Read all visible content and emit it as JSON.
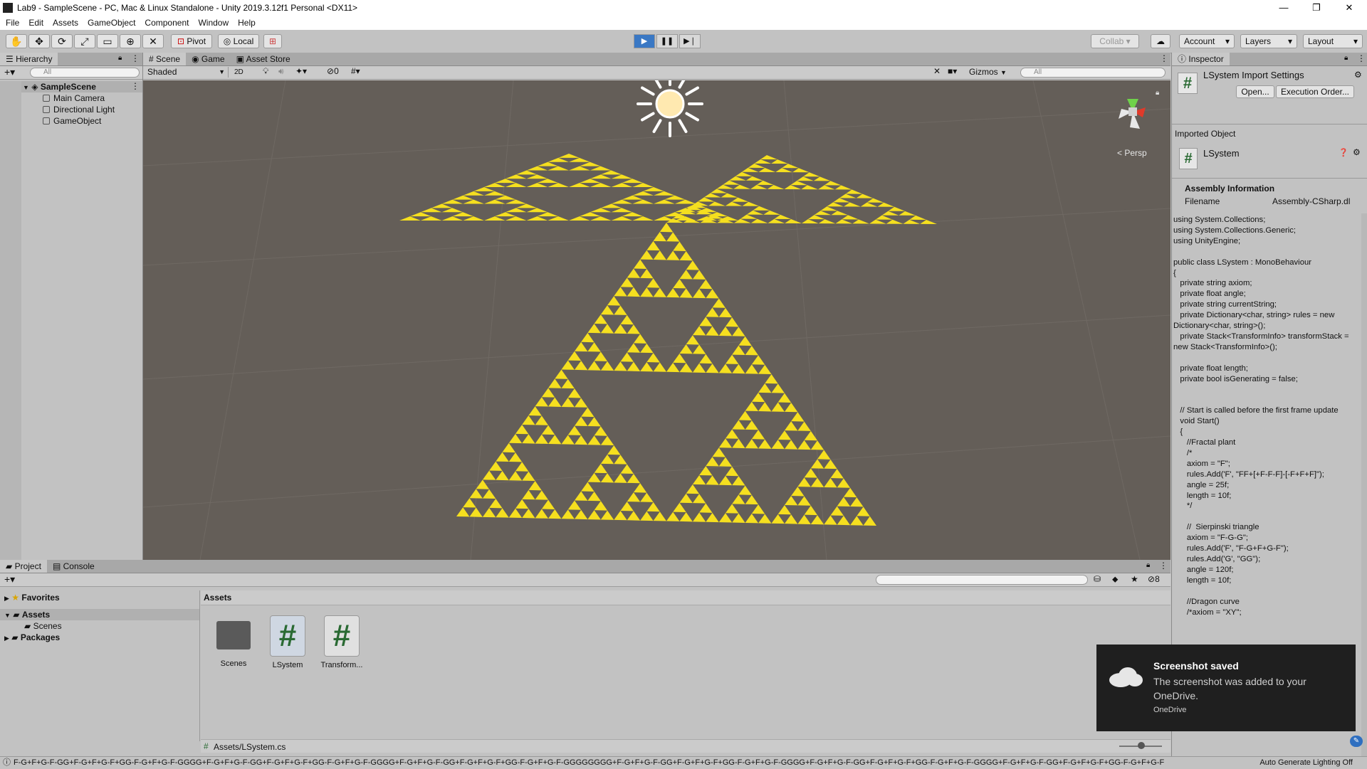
{
  "window": {
    "title": "Lab9 - SampleScene - PC, Mac & Linux Standalone - Unity 2019.3.12f1 Personal <DX11>",
    "minimize": "—",
    "maximize": "❐",
    "close": "✕"
  },
  "menu": [
    "File",
    "Edit",
    "Assets",
    "GameObject",
    "Component",
    "Window",
    "Help"
  ],
  "toolbar": {
    "tools": [
      "hand-tool-icon",
      "move-tool-icon",
      "rotate-tool-icon",
      "scale-tool-icon",
      "rect-tool-icon",
      "transform-tool-icon",
      "custom-tool-icon"
    ],
    "pivot": "Pivot",
    "local": "Local",
    "collab": "Collab",
    "account": "Account",
    "layers": "Layers",
    "layout": "Layout",
    "play_active_color": "#3a78c4"
  },
  "hierarchy": {
    "tab": "Hierarchy",
    "search_placeholder": "All",
    "scene": "SampleScene",
    "items": [
      "Main Camera",
      "Directional Light",
      "GameObject"
    ]
  },
  "scene_view": {
    "tabs": [
      "Scene",
      "Game",
      "Asset Store"
    ],
    "shading": "Shaded",
    "mode_2d": "2D",
    "hidden_count": "0",
    "gizmos": "Gizmos",
    "search_placeholder": "All",
    "persp": "< Persp",
    "background_color": "#645e58",
    "fractal_color": "#f5df1f"
  },
  "inspector": {
    "tab": "Inspector",
    "title": "LSystem Import Settings",
    "open": "Open...",
    "execution_order": "Execution Order...",
    "imported_object": "Imported Object",
    "object_name": "LSystem",
    "assembly_info": "Assembly Information",
    "filename_label": "Filename",
    "filename_value": "Assembly-CSharp.dl",
    "code": "using System.Collections;\nusing System.Collections.Generic;\nusing UnityEngine;\n\npublic class LSystem : MonoBehaviour\n{\n   private string axiom;\n   private float angle;\n   private string currentString;\n   private Dictionary<char, string> rules = new Dictionary<char, string>();\n   private Stack<TransformInfo> transformStack = new Stack<TransformInfo>();\n\n   private float length;\n   private bool isGenerating = false;\n\n\n   // Start is called before the first frame update\n   void Start()\n   {\n      //Fractal plant\n      /*\n      axiom = \"F\";\n      rules.Add('F', \"FF+[+F-F-F]-[-F+F+F]\");\n      angle = 25f;\n      length = 10f;\n      */\n\n      //  Sierpinski triangle\n      axiom = \"F-G-G\";\n      rules.Add('F', \"F-G+F+G-F\");\n      rules.Add('G', \"GG\");\n      angle = 120f;\n      length = 10f;\n\n      //Dragon curve\n      /*axiom = \"XY\";"
  },
  "project": {
    "tabs": [
      "Project",
      "Console"
    ],
    "hidden_count": "8",
    "tree": {
      "favorites": "Favorites",
      "assets": "Assets",
      "scenes": "Scenes",
      "packages": "Packages"
    },
    "breadcrumb": "Assets",
    "assets": [
      {
        "name": "Scenes",
        "type": "folder"
      },
      {
        "name": "LSystem",
        "type": "script"
      },
      {
        "name": "Transform...",
        "type": "script"
      }
    ],
    "selected_path": "Assets/LSystem.cs"
  },
  "status": {
    "text": "F-G+F+G-F-GG+F-G+F+G-F+GG-F-G+F+G-F-GGGG+F-G+F+G-F-GG+F-G+F+G-F+GG-F-G+F+G-F-GGGG+F-G+F+G-F-GG+F-G+F+G-F+GG-F-G+F+G-F-GGGGGGGG+F-G+F+G-F-GG+F-G+F+G-F+GG-F-G+F+G-F-GGGG+F-G+F+G-F-GG+F-G+F+G-F+GG-F-G+F+G-F-GGGG+F-G+F+G-F-GG+F-G+F+G-F+GG-F-G+F+G-F",
    "lighting": "Auto Generate Lighting Off"
  },
  "toast": {
    "title": "Screenshot saved",
    "body": "The screenshot was added to your OneDrive.",
    "source": "OneDrive"
  }
}
